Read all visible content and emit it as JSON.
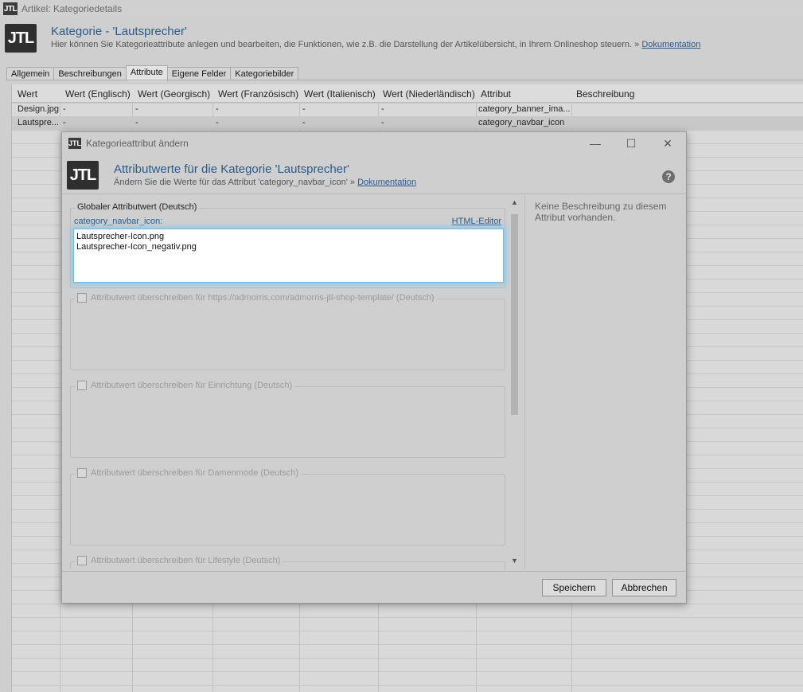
{
  "window": {
    "title": "Artikel: Kategoriedetails",
    "logo_text": "JTL"
  },
  "header": {
    "title": "Kategorie - 'Lautsprecher'",
    "subtitle": "Hier können Sie Kategorieattribute anlegen und bearbeiten, die Funktionen, wie z.B. die Darstellung der Artikelübersicht, in Ihrem Onlineshop steuern. »",
    "doc_link": "Dokumentation"
  },
  "tabs": [
    {
      "label": "Allgemein"
    },
    {
      "label": "Beschreibungen"
    },
    {
      "label": "Attribute"
    },
    {
      "label": "Eigene Felder"
    },
    {
      "label": "Kategoriebilder"
    }
  ],
  "grid": {
    "columns": [
      "Wert",
      "Wert (Englisch)",
      "Wert (Georgisch)",
      "Wert (Französisch)",
      "Wert (Italienisch)",
      "Wert (Niederländisch)",
      "Attribut",
      "Beschreibung"
    ],
    "rows": [
      {
        "cells": [
          "Design.jpg",
          "-",
          "-",
          "-",
          "-",
          "-",
          "category_banner_ima...",
          ""
        ]
      },
      {
        "cells": [
          "Lautspre...",
          "-",
          "-",
          "-",
          "-",
          "-",
          "category_navbar_icon",
          ""
        ]
      }
    ]
  },
  "dialog": {
    "window_title": "Kategorieattribut ändern",
    "minimize": "—",
    "maximize": "☐",
    "close": "✕",
    "title": "Attributwerte für die Kategorie 'Lautsprecher'",
    "subtitle": "Ändern Sie die Werte für das Attribut 'category_navbar_icon' »",
    "doc_link": "Dokumentation",
    "help": "?",
    "global_group": {
      "legend": "Globaler Attributwert (Deutsch)",
      "attribute_label": "category_navbar_icon:",
      "html_editor": "HTML-Editor",
      "value": "Lautsprecher-Icon.png\nLautsprecher-Icon_negativ.png"
    },
    "overrides": [
      {
        "label": "Attributwert überschreiben für https://admorris.com/admorris-jtl-shop-template/ (Deutsch)",
        "checked": false
      },
      {
        "label": "Attributwert überschreiben für Einrichtung (Deutsch)",
        "checked": false
      },
      {
        "label": "Attributwert überschreiben für Damenmode (Deutsch)",
        "checked": false
      },
      {
        "label": "Attributwert überschreiben für Lifestyle (Deutsch)",
        "checked": false
      }
    ],
    "description": "Keine Beschreibung zu diesem Attribut vorhanden.",
    "scroll_up": "▲",
    "scroll_down": "▼",
    "save_button": "Speichern",
    "cancel_button": "Abbrechen"
  }
}
